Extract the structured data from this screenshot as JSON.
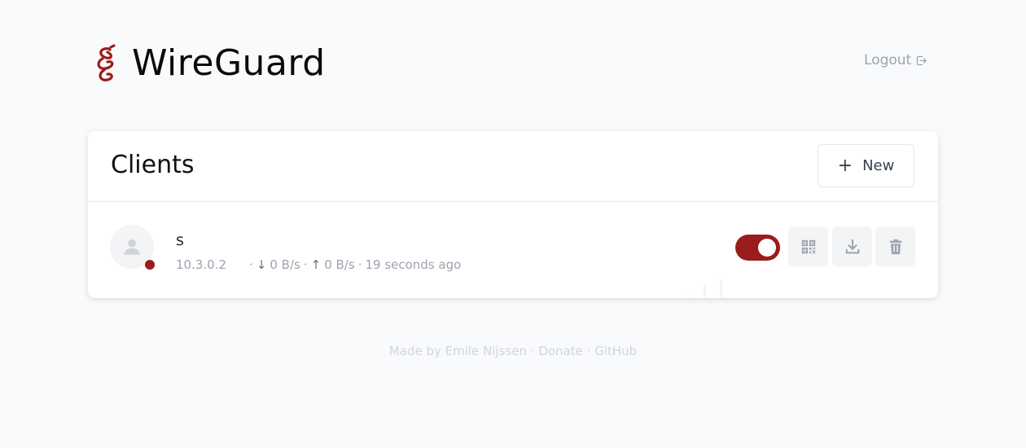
{
  "app": {
    "title": "WireGuard"
  },
  "header": {
    "logout_label": "Logout"
  },
  "clients_card": {
    "title": "Clients",
    "new_button_label": "New",
    "clients": [
      {
        "name": "s",
        "address": "10.3.0.2",
        "separator": "·",
        "download_rate": "0 B/s",
        "upload_rate": "0 B/s",
        "last_seen": "19 seconds ago",
        "enabled": true
      }
    ]
  },
  "footer": {
    "made_by": "Made by Emile Nijssen",
    "donate": "Donate",
    "github": "GitHub",
    "sep": "·"
  },
  "colors": {
    "accent": "#9b1c1c",
    "background": "#f9fafb",
    "muted_text": "#9ca3af",
    "footer_text": "#d1d5db",
    "button_bg": "#f3f4f6"
  }
}
